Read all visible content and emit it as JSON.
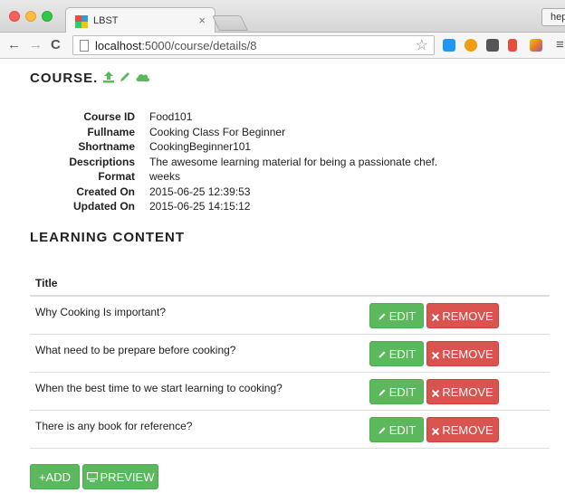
{
  "browser": {
    "tab_title": "LBST",
    "tab_close": "×",
    "url_host": "localhost",
    "url_path": ":5000/course/details/8",
    "profile_label": "hep",
    "star_glyph": "☆",
    "back_glyph": "←",
    "forward_glyph": "→",
    "reload_glyph": "C",
    "menu_glyph": "≡"
  },
  "course": {
    "heading": "COURSE.",
    "icons": [
      "upload-icon",
      "pencil-icon",
      "cloud-icon"
    ],
    "accent_color": "#5cb85c",
    "details": [
      {
        "label": "Course ID",
        "value": "Food101"
      },
      {
        "label": "Fullname",
        "value": "Cooking Class For Beginner"
      },
      {
        "label": "Shortname",
        "value": "CookingBeginner101"
      },
      {
        "label": "Descriptions",
        "value": "The awesome learning material for being a passionate chef."
      },
      {
        "label": "Format",
        "value": "weeks"
      },
      {
        "label": "Created On",
        "value": "2015-06-25 12:39:53"
      },
      {
        "label": "Updated On",
        "value": "2015-06-25 14:15:12"
      }
    ]
  },
  "learning": {
    "heading": "LEARNING CONTENT",
    "column_title": "Title",
    "edit_label": "EDIT",
    "remove_label": "REMOVE",
    "rows": [
      {
        "title": "Why Cooking Is important?"
      },
      {
        "title": "What need to be prepare before cooking?"
      },
      {
        "title": "When the best time to we start learning to cooking?"
      },
      {
        "title": "There is any book for reference?"
      }
    ]
  },
  "actions": {
    "add_label": "+ADD",
    "preview_label": "PREVIEW"
  },
  "colors": {
    "success": "#5cb85c",
    "danger": "#d9534f"
  }
}
